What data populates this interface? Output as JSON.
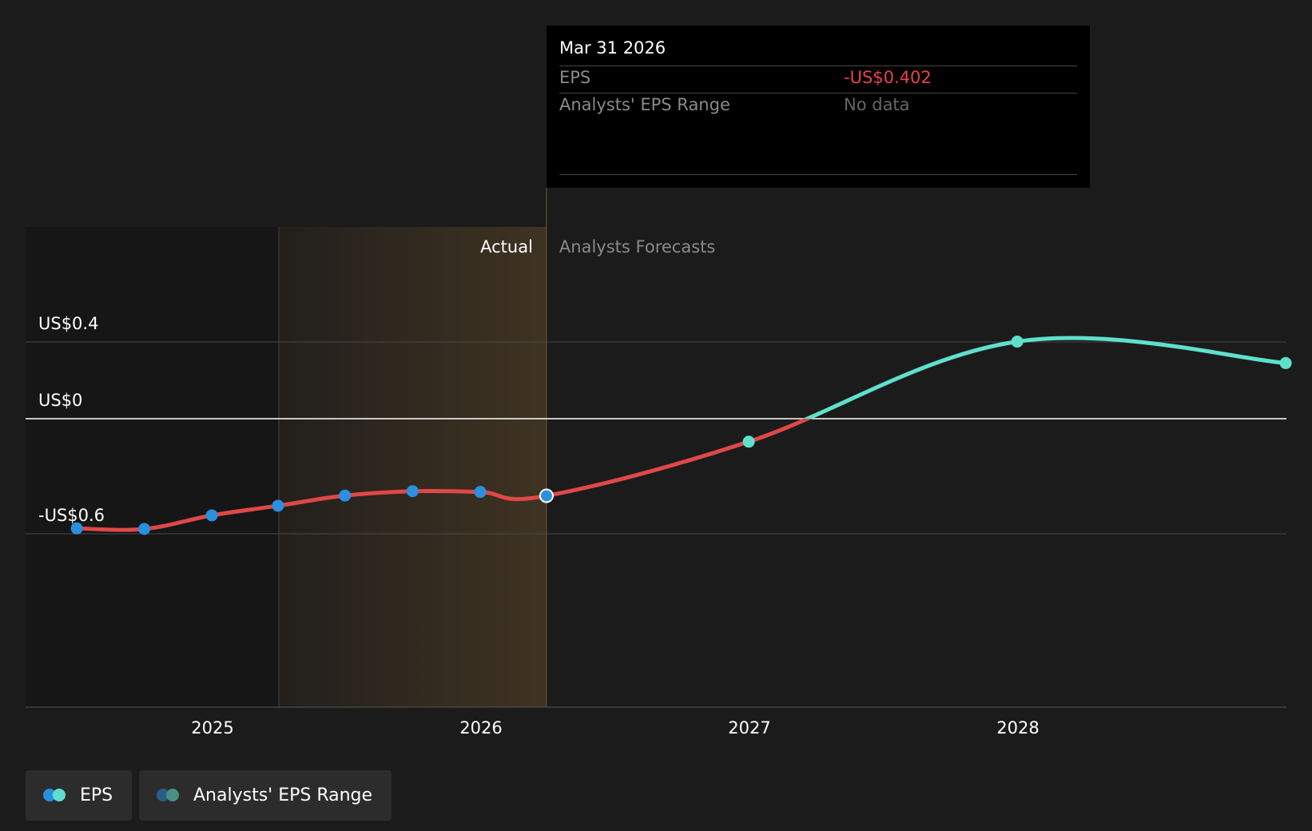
{
  "chart_data": {
    "type": "line",
    "y_ticks": [
      "US$0.4",
      "US$0",
      "-US$0.6"
    ],
    "x_ticks": [
      "2025",
      "2026",
      "2027",
      "2028"
    ],
    "ylim": [
      -0.6,
      0.4
    ],
    "region_labels": {
      "actual": "Actual",
      "forecast": "Analysts Forecasts"
    },
    "series": [
      {
        "name": "EPS",
        "points": [
          {
            "date": "2024-06-30",
            "value": -0.572
          },
          {
            "date": "2024-09-30",
            "value": -0.575
          },
          {
            "date": "2024-12-31",
            "value": -0.504
          },
          {
            "date": "2025-03-31",
            "value": -0.454
          },
          {
            "date": "2025-06-30",
            "value": -0.401
          },
          {
            "date": "2025-09-30",
            "value": -0.378
          },
          {
            "date": "2025-12-31",
            "value": -0.382
          },
          {
            "date": "2026-03-31",
            "value": -0.402
          }
        ]
      },
      {
        "name": "EPS forecast",
        "points": [
          {
            "date": "2026-03-31",
            "value": -0.402
          },
          {
            "date": "2026-12-31",
            "value": -0.12
          },
          {
            "date": "2027-12-31",
            "value": 0.402
          },
          {
            "date": "2028-12-31",
            "value": 0.29
          }
        ]
      }
    ],
    "colors": {
      "negative": "#e04848",
      "positive": "#5fe0cc",
      "actual_point": "#2b8fe0",
      "forecast_point": "#5fe0cc"
    },
    "tooltip": {
      "date": "Mar 31 2026",
      "rows": [
        {
          "label": "EPS",
          "value": "-US$0.402",
          "color": "#e8414f"
        },
        {
          "label": "Analysts' EPS Range",
          "value": "No data",
          "color": "#666666"
        }
      ]
    },
    "legend": [
      {
        "label": "EPS",
        "colors": [
          "#2b8fe0",
          "#5fe0cc"
        ]
      },
      {
        "label": "Analysts' EPS Range",
        "colors": [
          "#2a5f85",
          "#4a8f85"
        ]
      }
    ]
  }
}
